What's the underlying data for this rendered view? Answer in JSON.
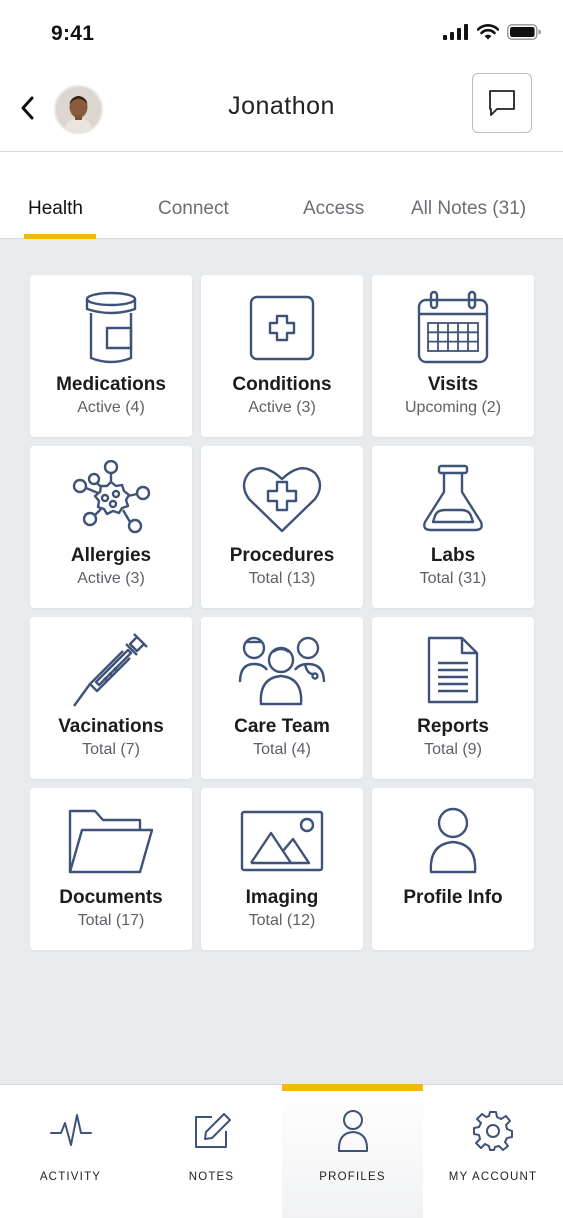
{
  "status_bar": {
    "time": "9:41"
  },
  "header": {
    "title": "Jonathon"
  },
  "tabs": [
    {
      "label": "Health"
    },
    {
      "label": "Connect"
    },
    {
      "label": "Access"
    },
    {
      "label": "All Notes (31)"
    }
  ],
  "cards": [
    {
      "label": "Medications",
      "sub": "Active (4)",
      "icon": "pill-bottle-icon"
    },
    {
      "label": "Conditions",
      "sub": "Active (3)",
      "icon": "medical-cross-icon"
    },
    {
      "label": "Visits",
      "sub": "Upcoming (2)",
      "icon": "calendar-icon"
    },
    {
      "label": "Allergies",
      "sub": "Active (3)",
      "icon": "allergen-icon"
    },
    {
      "label": "Procedures",
      "sub": "Total (13)",
      "icon": "heart-cross-icon"
    },
    {
      "label": "Labs",
      "sub": "Total (31)",
      "icon": "flask-icon"
    },
    {
      "label": "Vacinations",
      "sub": "Total (7)",
      "icon": "syringe-icon"
    },
    {
      "label": "Care Team",
      "sub": "Total (4)",
      "icon": "care-team-icon"
    },
    {
      "label": "Reports",
      "sub": "Total (9)",
      "icon": "document-icon"
    },
    {
      "label": "Documents",
      "sub": "Total (17)",
      "icon": "folder-icon"
    },
    {
      "label": "Imaging",
      "sub": "Total (12)",
      "icon": "image-icon"
    },
    {
      "label": "Profile Info",
      "sub": "",
      "icon": "person-icon"
    }
  ],
  "bottom_nav": [
    {
      "label": "ACTIVITY",
      "icon": "pulse-icon"
    },
    {
      "label": "NOTES",
      "icon": "edit-note-icon"
    },
    {
      "label": "PROFILES",
      "icon": "person-icon"
    },
    {
      "label": "MY ACCOUNT",
      "icon": "gear-icon"
    }
  ],
  "colors": {
    "accent": "#f5b90d",
    "icon_stroke": "#3f5379",
    "background": "#e8ebee"
  }
}
